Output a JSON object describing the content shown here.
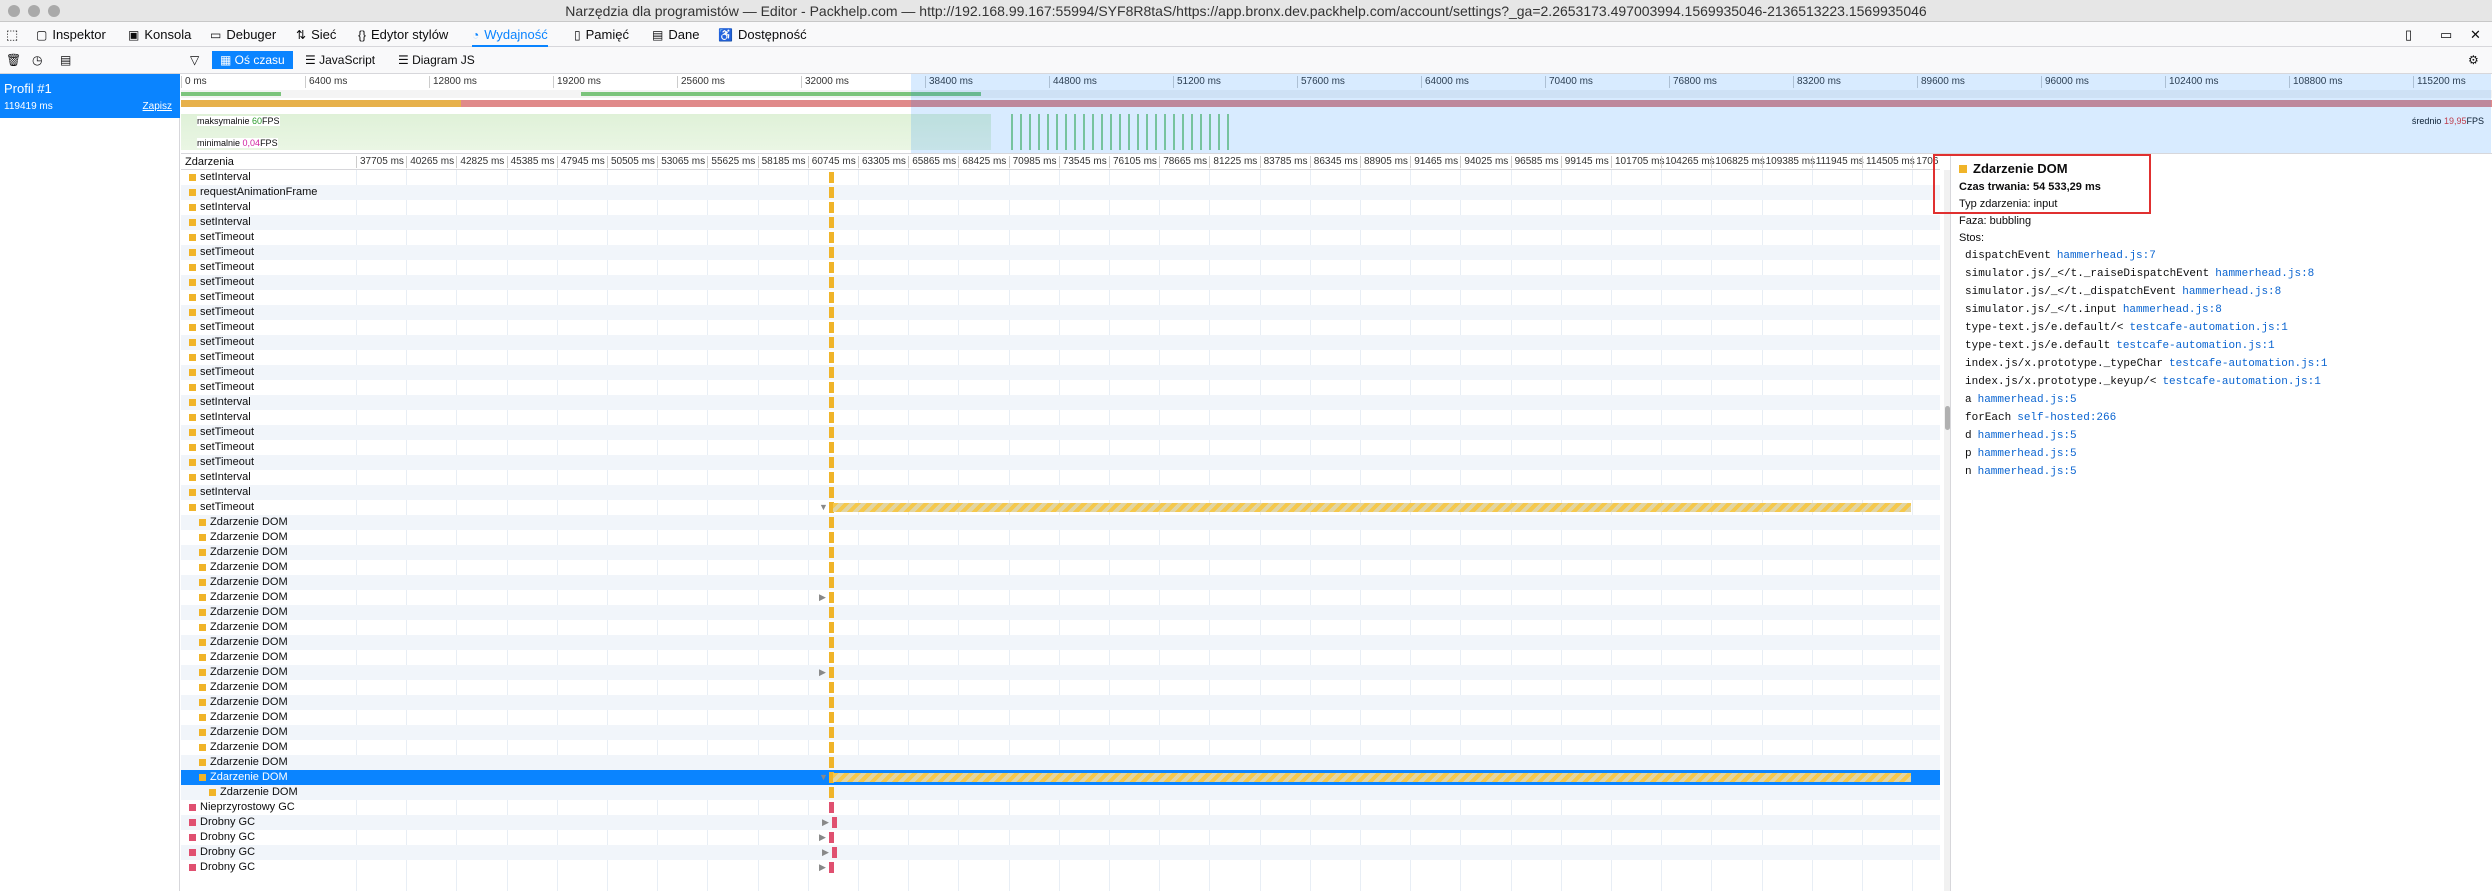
{
  "window": {
    "title": "Narzędzia dla programistów — Editor - Packhelp.com — http://192.168.99.167:55994/SYF8R8taS/https://app.bronx.dev.packhelp.com/account/settings?_ga=2.2653173.497003994.1569935046-2136513223.1569935046"
  },
  "tabs": [
    {
      "label": "Inspektor",
      "icon": "inspector-icon"
    },
    {
      "label": "Konsola",
      "icon": "console-icon"
    },
    {
      "label": "Debuger",
      "icon": "debugger-icon"
    },
    {
      "label": "Sieć",
      "icon": "network-icon"
    },
    {
      "label": "Edytor stylów",
      "icon": "style-editor-icon"
    },
    {
      "label": "Wydajność",
      "icon": "performance-icon",
      "selected": true
    },
    {
      "label": "Pamięć",
      "icon": "memory-icon"
    },
    {
      "label": "Dane",
      "icon": "storage-icon"
    },
    {
      "label": "Dostępność",
      "icon": "accessibility-icon"
    }
  ],
  "toolbar": {
    "views": [
      "Oś czasu",
      "JavaScript",
      "Diagram JS"
    ]
  },
  "profile": {
    "name": "Profil #1",
    "duration": "119419 ms",
    "save": "Zapisz"
  },
  "overview": {
    "ticks": [
      "0 ms",
      "6400 ms",
      "12800 ms",
      "19200 ms",
      "25600 ms",
      "32000 ms",
      "38400 ms",
      "44800 ms",
      "51200 ms",
      "57600 ms",
      "64000 ms",
      "70400 ms",
      "76800 ms",
      "83200 ms",
      "89600 ms",
      "96000 ms",
      "102400 ms",
      "108800 ms",
      "115200 ms"
    ],
    "fps_max_label": "maksymalnie",
    "fps_max": "60",
    "fps_min_label": "minimalnie",
    "fps_min": "0,04",
    "fps_unit": "FPS",
    "avg_label": "średnio",
    "avg": "19,95"
  },
  "ruler": {
    "header": "Zdarzenia",
    "ticks": [
      "37705 ms",
      "40265 ms",
      "42825 ms",
      "45385 ms",
      "47945 ms",
      "50505 ms",
      "53065 ms",
      "55625 ms",
      "58185 ms",
      "60745 ms",
      "63305 ms",
      "65865 ms",
      "68425 ms",
      "70985 ms",
      "73545 ms",
      "76105 ms",
      "78665 ms",
      "81225 ms",
      "83785 ms",
      "86345 ms",
      "88905 ms",
      "91465 ms",
      "94025 ms",
      "96585 ms",
      "99145 ms",
      "101705 ms",
      "104265 ms",
      "106825 ms",
      "109385 ms",
      "111945 ms",
      "114505 ms",
      "1706"
    ]
  },
  "events": [
    {
      "label": "setInterval",
      "indent": 0
    },
    {
      "label": "requestAnimationFrame",
      "indent": 0
    },
    {
      "label": "setInterval",
      "indent": 0
    },
    {
      "label": "setInterval",
      "indent": 0
    },
    {
      "label": "setTimeout",
      "indent": 0
    },
    {
      "label": "setTimeout",
      "indent": 0
    },
    {
      "label": "setTimeout",
      "indent": 0
    },
    {
      "label": "setTimeout",
      "indent": 0
    },
    {
      "label": "setTimeout",
      "indent": 0
    },
    {
      "label": "setTimeout",
      "indent": 0
    },
    {
      "label": "setTimeout",
      "indent": 0
    },
    {
      "label": "setTimeout",
      "indent": 0
    },
    {
      "label": "setTimeout",
      "indent": 0
    },
    {
      "label": "setTimeout",
      "indent": 0
    },
    {
      "label": "setTimeout",
      "indent": 0
    },
    {
      "label": "setInterval",
      "indent": 0
    },
    {
      "label": "setInterval",
      "indent": 0
    },
    {
      "label": "setTimeout",
      "indent": 0
    },
    {
      "label": "setTimeout",
      "indent": 0
    },
    {
      "label": "setTimeout",
      "indent": 0
    },
    {
      "label": "setInterval",
      "indent": 0
    },
    {
      "label": "setInterval",
      "indent": 0
    },
    {
      "label": "setTimeout",
      "indent": 0,
      "twisty": true,
      "bar": true
    },
    {
      "label": "Zdarzenie DOM",
      "indent": 1
    },
    {
      "label": "Zdarzenie DOM",
      "indent": 1
    },
    {
      "label": "Zdarzenie DOM",
      "indent": 1
    },
    {
      "label": "Zdarzenie DOM",
      "indent": 1
    },
    {
      "label": "Zdarzenie DOM",
      "indent": 1
    },
    {
      "label": "Zdarzenie DOM",
      "indent": 1,
      "twisty": true
    },
    {
      "label": "Zdarzenie DOM",
      "indent": 1
    },
    {
      "label": "Zdarzenie DOM",
      "indent": 1
    },
    {
      "label": "Zdarzenie DOM",
      "indent": 1
    },
    {
      "label": "Zdarzenie DOM",
      "indent": 1
    },
    {
      "label": "Zdarzenie DOM",
      "indent": 1,
      "twisty": true
    },
    {
      "label": "Zdarzenie DOM",
      "indent": 1
    },
    {
      "label": "Zdarzenie DOM",
      "indent": 1
    },
    {
      "label": "Zdarzenie DOM",
      "indent": 1
    },
    {
      "label": "Zdarzenie DOM",
      "indent": 1
    },
    {
      "label": "Zdarzenie DOM",
      "indent": 1
    },
    {
      "label": "Zdarzenie DOM",
      "indent": 1
    },
    {
      "label": "Zdarzenie DOM",
      "indent": 1,
      "selected": true,
      "twisty": true,
      "bar": true
    },
    {
      "label": "Zdarzenie DOM",
      "indent": 2
    },
    {
      "label": "Nieprzyrostowy GC",
      "indent": 0,
      "gc": true
    },
    {
      "label": "Drobny GC",
      "indent": 0,
      "gc": true,
      "twisty": true
    },
    {
      "label": "Drobny GC",
      "indent": 0,
      "gc": true,
      "twisty": true
    },
    {
      "label": "Drobny GC",
      "indent": 0,
      "gc": true,
      "twisty": true
    },
    {
      "label": "Drobny GC",
      "indent": 0,
      "gc": true,
      "twisty": true
    }
  ],
  "details": {
    "title": "Zdarzenie DOM",
    "duration_label": "Czas trwania:",
    "duration": "54 533,29 ms",
    "type_label": "Typ zdarzenia:",
    "type": "input",
    "phase_label": "Faza:",
    "phase": "bubbling",
    "stack_label": "Stos:",
    "stack": [
      {
        "fn": "dispatchEvent",
        "src": "hammerhead.js:7"
      },
      {
        "fn": "simulator.js/_</t._raiseDispatchEvent",
        "src": "hammerhead.js:8"
      },
      {
        "fn": "simulator.js/_</t._dispatchEvent",
        "src": "hammerhead.js:8"
      },
      {
        "fn": "simulator.js/_</t.input",
        "src": "hammerhead.js:8"
      },
      {
        "fn": "type-text.js/e.default/<",
        "src": "testcafe-automation.js:1"
      },
      {
        "fn": "type-text.js/e.default",
        "src": "testcafe-automation.js:1"
      },
      {
        "fn": "index.js/x.prototype._typeChar",
        "src": "testcafe-automation.js:1"
      },
      {
        "fn": "index.js/x.prototype._keyup/<",
        "src": "testcafe-automation.js:1"
      },
      {
        "fn": "a",
        "src": "hammerhead.js:5"
      },
      {
        "fn": "forEach",
        "src": "self-hosted:266"
      },
      {
        "fn": "d",
        "src": "hammerhead.js:5"
      },
      {
        "fn": "p",
        "src": "hammerhead.js:5"
      },
      {
        "fn": "n",
        "src": "hammerhead.js:5"
      }
    ]
  },
  "colors": {
    "accent": "#0a84ff",
    "dom": "#f0b429",
    "gc": "#e05070",
    "highlight": "#e03030"
  }
}
